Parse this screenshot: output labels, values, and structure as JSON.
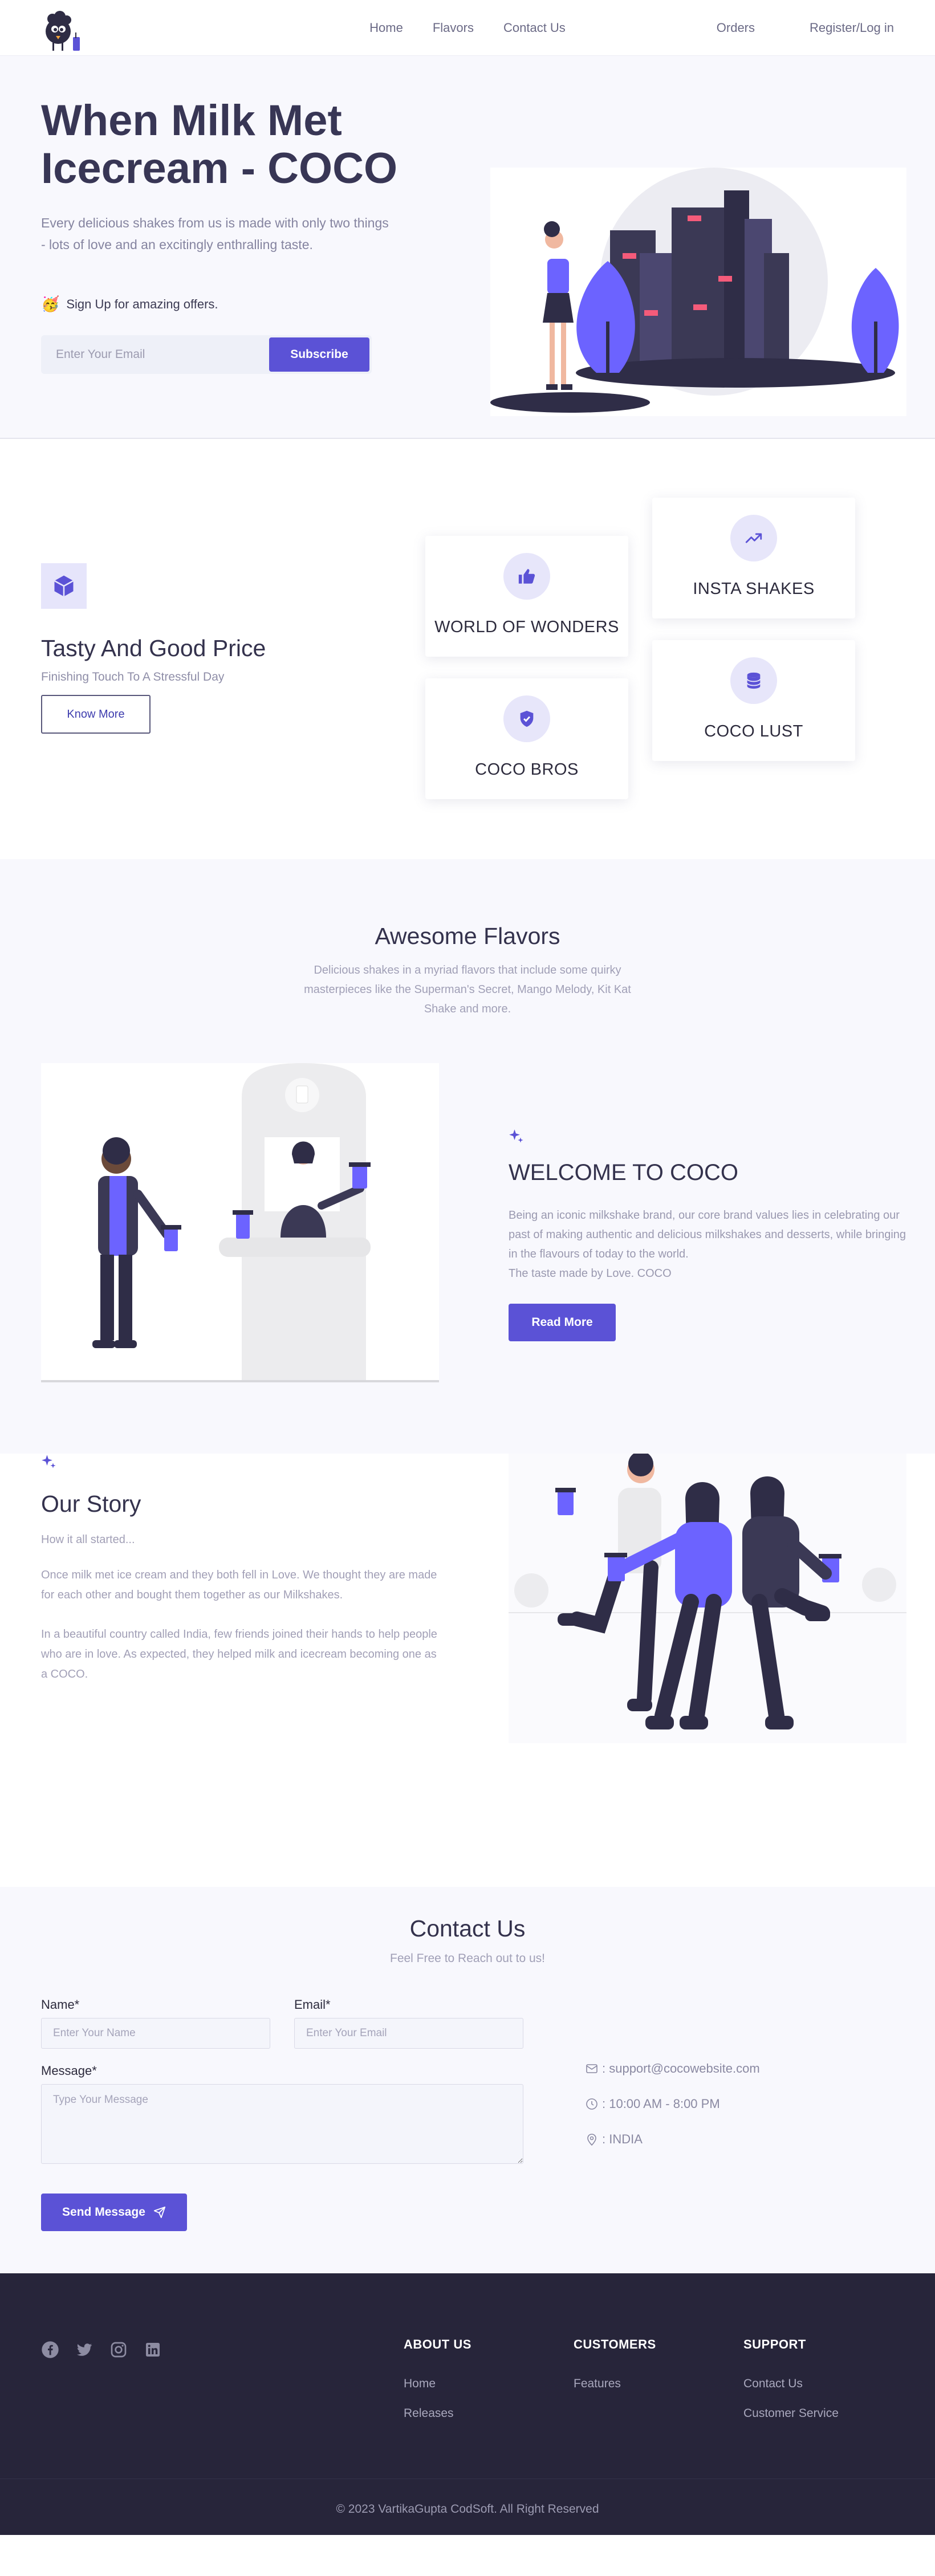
{
  "nav": {
    "links": [
      "Home",
      "Flavors",
      "Contact Us"
    ],
    "orders": "Orders",
    "login": "Register/Log in"
  },
  "hero": {
    "title": "When Milk Met Icecream - COCO",
    "subtitle": "Every delicious shakes from us is made with only two things - lots of love and an excitingly enthralling taste.",
    "signup_emoji": "🥳",
    "signup_text": "Sign Up for amazing offers.",
    "email_placeholder": "Enter Your Email",
    "subscribe": "Subscribe"
  },
  "features": {
    "title": "Tasty And Good Price",
    "tagline": "Finishing Touch To A Stressful Day",
    "know_more": "Know More",
    "cards": [
      {
        "label": "WORLD OF WONDERS",
        "icon": "thumbs-up-icon"
      },
      {
        "label": "INSTA SHAKES",
        "icon": "trending-up-icon"
      },
      {
        "label": "COCO BROS",
        "icon": "shield-check-icon"
      },
      {
        "label": "COCO LUST",
        "icon": "database-icon"
      }
    ]
  },
  "flavors": {
    "title": "Awesome Flavors",
    "description": "Delicious shakes in a myriad flavors that include some quirky masterpieces like the Superman's Secret, Mango Melody, Kit Kat Shake and more.",
    "welcome_title": "WELCOME TO COCO",
    "welcome_text": "Being an iconic milkshake brand, our core brand values lies in celebrating our past of making authentic and delicious milkshakes and desserts, while bringing in the flavours of today to the world.",
    "welcome_tagline": "The taste made by Love. COCO",
    "read_more": "Read More"
  },
  "story": {
    "title": "Our Story",
    "p1": "How it all started...",
    "p2": "Once milk met ice cream and they both fell in Love. We thought they are made for each other and bought them together as our Milkshakes.",
    "p3": "In a beautiful country called India, few friends joined their hands to help people who are in love. As expected, they helped milk and icecream becoming one as a COCO."
  },
  "contact": {
    "title": "Contact Us",
    "subtitle": "Feel Free to Reach out to us!",
    "name_label": "Name*",
    "name_placeholder": "Enter Your Name",
    "email_label": "Email*",
    "email_placeholder": "Enter Your Email",
    "message_label": "Message*",
    "message_placeholder": "Type Your Message",
    "send": "Send Message",
    "email": " : support@cocowebsite.com",
    "hours": " : 10:00 AM - 8:00 PM",
    "location": " : INDIA"
  },
  "footer": {
    "socials": [
      "facebook-icon",
      "twitter-icon",
      "instagram-icon",
      "linkedin-icon"
    ],
    "about_title": "ABOUT US",
    "about_links": [
      "Home",
      "Releases"
    ],
    "customers_title": "CUSTOMERS",
    "customers_links": [
      "Features"
    ],
    "support_title": "SUPPORT",
    "support_links": [
      "Contact Us",
      "Customer Service"
    ],
    "copyright": "© 2023 VartikaGupta CodSoft. All Right Reserved"
  },
  "colors": {
    "accent": "#5b52d6",
    "dark": "#27253a",
    "light_bg": "#f8f8fd"
  }
}
